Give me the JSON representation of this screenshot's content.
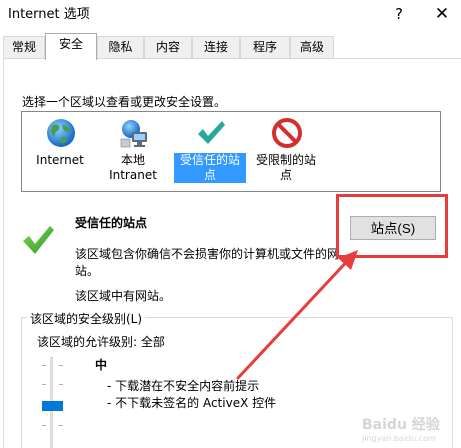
{
  "window": {
    "title": "Internet 选项",
    "help_glyph": "?",
    "close_glyph": "✕"
  },
  "tabs": [
    {
      "label": "常规",
      "active": false
    },
    {
      "label": "安全",
      "active": true
    },
    {
      "label": "隐私",
      "active": false
    },
    {
      "label": "内容",
      "active": false
    },
    {
      "label": "连接",
      "active": false
    },
    {
      "label": "程序",
      "active": false
    },
    {
      "label": "高级",
      "active": false
    }
  ],
  "security": {
    "prompt": "选择一个区域以查看或更改安全设置。",
    "zones": [
      {
        "label_line1": "Internet",
        "label_line2": "",
        "icon": "globe-icon",
        "selected": false
      },
      {
        "label_line1": "本地",
        "label_line2": "Intranet",
        "icon": "local-intranet-icon",
        "selected": false
      },
      {
        "label_line1": "受信任的站",
        "label_line2": "点",
        "icon": "trusted-sites-check-icon",
        "selected": true
      },
      {
        "label_line1": "受限制的站",
        "label_line2": "点",
        "icon": "restricted-sites-icon",
        "selected": false
      }
    ],
    "selected_zone": {
      "title": "受信任的站点",
      "desc_line1": "该区域包含你确信不会损害你的计算机或文件的网",
      "desc_line2": "站。",
      "note": "该区域中有网站。",
      "sites_button": "站点(S)"
    },
    "level_group": {
      "legend": "该区域的安全级别(L)",
      "allowed": "该区域的允许级别: 全部",
      "level_name": "中",
      "bullets": [
        "- 下载潜在不安全内容前提示",
        "- 不下载未签名的 ActiveX 控件"
      ],
      "slider_level": 0.5
    }
  },
  "colors": {
    "accent": "#0078d7",
    "selection": "#3399ff",
    "annotation": "#e83d3d"
  },
  "watermark": {
    "text": "Baidu 经验",
    "sub": "jingyan.baidu.com"
  }
}
